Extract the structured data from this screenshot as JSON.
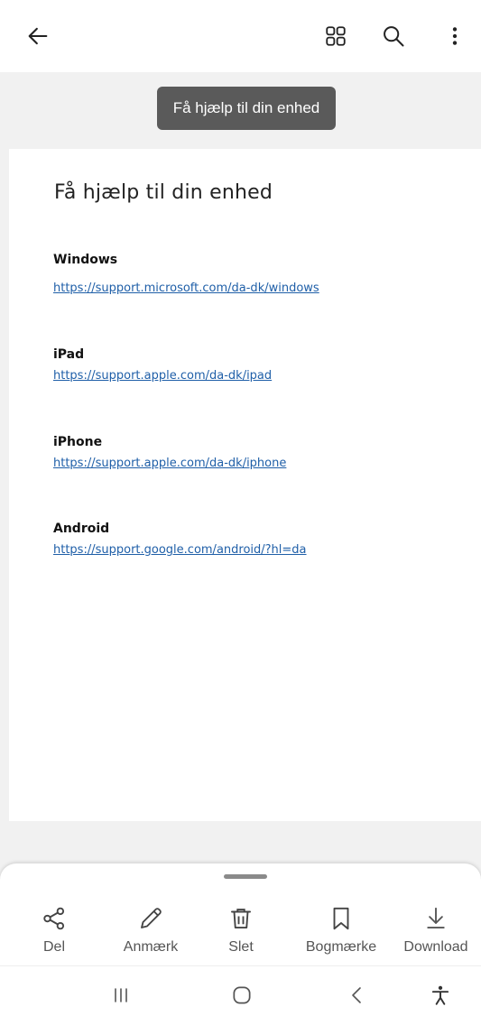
{
  "toolbar": {
    "back_icon": "arrow-left-icon",
    "grid_icon": "grid-icon",
    "search_icon": "search-icon",
    "more_icon": "more-vert-icon"
  },
  "document": {
    "tooltip_title": "Få hjælp til din enhed",
    "title": "Få hjælp til din enhed",
    "sections": [
      {
        "heading": "Windows",
        "link": "https://support.microsoft.com/da-dk/windows"
      },
      {
        "heading": "iPad",
        "link": "https://support.apple.com/da-dk/ipad"
      },
      {
        "heading": "iPhone",
        "link": "https://support.apple.com/da-dk/iphone"
      },
      {
        "heading": "Android",
        "link": "https://support.google.com/android/?hl=da"
      }
    ]
  },
  "bottom_actions": [
    {
      "label": "Del",
      "icon": "share-icon"
    },
    {
      "label": "Anmærk",
      "icon": "pencil-icon"
    },
    {
      "label": "Slet",
      "icon": "trash-icon"
    },
    {
      "label": "Bogmærke",
      "icon": "bookmark-icon"
    },
    {
      "label": "Download",
      "icon": "download-icon"
    }
  ],
  "navbar": {
    "recents_icon": "recents-icon",
    "home_icon": "home-icon",
    "back_icon": "nav-back-icon",
    "accessibility_icon": "accessibility-icon"
  },
  "colors": {
    "link": "#1f5fa8",
    "viewer_bg": "#f1f1f1",
    "tooltip_bg": "#5a5a5a"
  }
}
